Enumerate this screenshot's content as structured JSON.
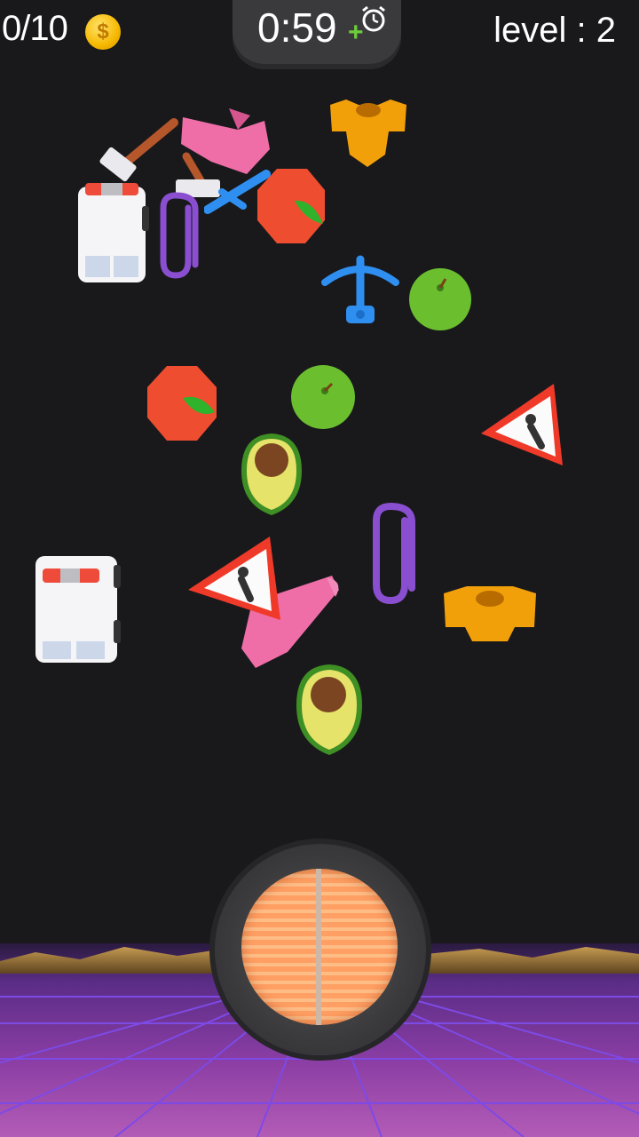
{
  "hud": {
    "score": "0/10",
    "coin_symbol": "$",
    "timer": "0:59",
    "timer_bonus": "+",
    "level": "level : 2"
  },
  "icons": {
    "coin": "coin-icon",
    "stopwatch": "stopwatch-icon"
  },
  "items": [
    "hammer",
    "pink-shoe",
    "golden-armor",
    "ambulance",
    "paperclip",
    "pink-chair",
    "blue-crossbow",
    "red-tomato",
    "blue-anchor",
    "green-apple",
    "red-tomato",
    "green-apple",
    "warning-sign",
    "avocado",
    "paperclip",
    "ambulance",
    "warning-sign",
    "pink-cone",
    "golden-armor",
    "avocado"
  ],
  "colors": {
    "background": "#19191b",
    "tomato": "#ef4d30",
    "apple": "#6bbf2f",
    "avocado": "#e6e36a",
    "armor": "#f2a00a",
    "paperclip": "#8a4fd0",
    "pink": "#ef6ea8",
    "crossbow": "#2f8ff0",
    "floor_top": "#b28a47",
    "floor_grid": "#6f3bd9",
    "collector": "#ffab75"
  }
}
